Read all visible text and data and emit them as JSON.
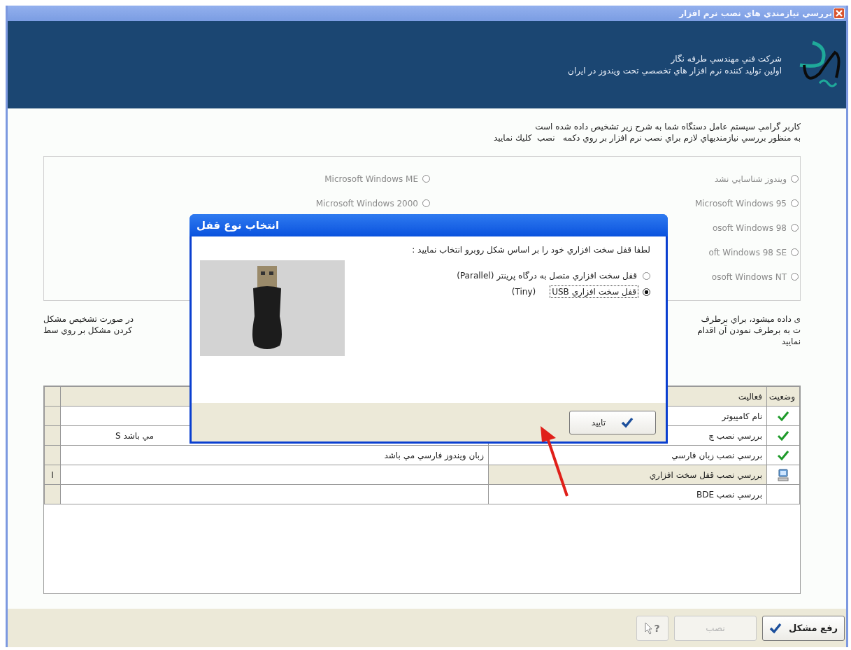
{
  "window": {
    "title": "بررسي نيازمندي هاي نصب نرم افزار"
  },
  "header": {
    "company": "شرکت فني مهندسي طرفه نگار",
    "tagline": "اولين توليد كننده نرم افزار هاي تخصصي تحت ويندوز در ايران"
  },
  "intro": [
    "کاربر گرامي سيستم عامل دستگاه شما به شرح زير تشخيص داده شده است",
    "به منظور بررسي نيازمنديهاي لازم براي نصب نرم افزار بر روي دكمه   نصب  كليك نماييد"
  ],
  "os_columns": [
    {
      "options": [
        {
          "label": "ويندوز شناسايي نشد",
          "selected": false
        },
        {
          "label": "Microsoft Windows 95",
          "selected": false
        },
        {
          "label": "osoft Windows 98",
          "selected": false
        },
        {
          "label": "oft Windows 98 SE",
          "selected": false
        },
        {
          "label": "osoft Windows NT",
          "selected": false
        }
      ]
    },
    {
      "options": [
        {
          "label": "Microsoft Windows ME",
          "selected": false
        },
        {
          "label": "Microsoft Windows 2000",
          "selected": false
        }
      ]
    }
  ],
  "notice": [
    {
      "part_1": "در صورت تشخيص مشكل",
      "part_2": "ی داده میشود، براي برطرف"
    },
    {
      "part_1": "کردن مشکل بر روي سط",
      "part_2": "ت به برطرف نمودن آن اقدام"
    },
    {
      "part_2": "نماييد"
    }
  ],
  "table": {
    "columns": {
      "status": "وضعيت",
      "activity": "فعاليت"
    },
    "rows": [
      {
        "kind": "done",
        "activity": "نام كامپيوتر",
        "selected": false
      },
      {
        "kind": "done",
        "activity": "بررسي نصب چ",
        "result": "S مي باشد",
        "selected": false
      },
      {
        "kind": "done",
        "activity": "بررسي نصب زبان فارسي",
        "result": "زبان ويندوز فارسي مي باشد",
        "selected": false
      },
      {
        "kind": "current",
        "activity": "بررسي نصب قفل سخت افزاري",
        "indicator": "I",
        "selected": true
      },
      {
        "kind": "pending",
        "activity": "بررسي نصب BDE",
        "selected": false
      }
    ]
  },
  "dialog": {
    "title": "انتخاب نوع قفل",
    "prompt": "لطفا قفل سخت افزاري خود را بر اساس شكل روبرو انتخاب نماييد :",
    "options": [
      {
        "label": "قفل سخت افزاري متصل به درگاه پرينتر (Parallel)",
        "selected": false
      },
      {
        "label": "قفل سخت افزاري USB",
        "note": "(Tiny)",
        "selected": true
      }
    ],
    "ok_button": "تاييد"
  },
  "footer": {
    "buttons": [
      {
        "label": "رفع مشکل",
        "kind": "fix",
        "disabled": false
      },
      {
        "label": "نصب",
        "kind": "install",
        "disabled": true
      }
    ],
    "help": "?"
  }
}
